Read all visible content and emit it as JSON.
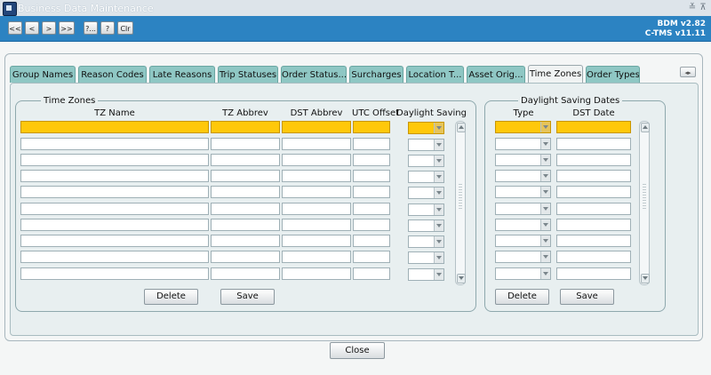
{
  "window": {
    "title": "Business Data Maintenance",
    "minimize_glyph": "≚",
    "maximize_glyph": "⊼"
  },
  "toolbar": {
    "first_label": "<<",
    "prev_label": "<",
    "next_label": ">",
    "last_label": ">>",
    "query_label": "?...",
    "help_label": "?",
    "clear_label": "Clr"
  },
  "version": {
    "line1": "BDM v2.82",
    "line2": "C-TMS v11.11"
  },
  "tabs": [
    {
      "label": "Group Names"
    },
    {
      "label": "Reason Codes"
    },
    {
      "label": "Late Reasons"
    },
    {
      "label": "Trip Statuses"
    },
    {
      "label": "Order Status..."
    },
    {
      "label": "Surcharges"
    },
    {
      "label": "Location T..."
    },
    {
      "label": "Asset Orig..."
    },
    {
      "label": "Time Zones"
    },
    {
      "label": "Order Types"
    }
  ],
  "tab_scroll_glyph": "◂▸",
  "time_zones": {
    "legend": "Time Zones",
    "headers": {
      "tz_name": "TZ Name",
      "tz_abbrev": "TZ Abbrev",
      "dst_abbrev": "DST Abbrev",
      "utc_offset": "UTC Offset",
      "daylight_saving": "Daylight Saving"
    },
    "delete_label": "Delete",
    "save_label": "Save"
  },
  "dst_dates": {
    "legend": "Daylight Saving Dates",
    "headers": {
      "type": "Type",
      "dst_date": "DST Date"
    },
    "delete_label": "Delete",
    "save_label": "Save"
  },
  "footer": {
    "close_label": "Close"
  },
  "colors": {
    "header_blue": "#2c83c2",
    "tab_teal": "#8fc7c4",
    "selection_yellow": "#ffc80a"
  }
}
